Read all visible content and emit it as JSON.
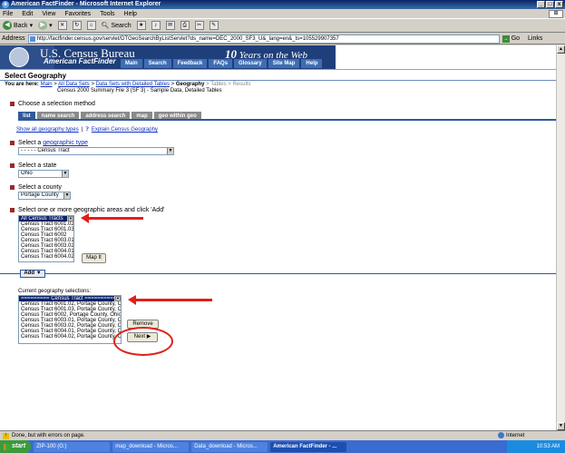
{
  "window": {
    "title": "American FactFinder - Microsoft Internet Explorer",
    "controls": [
      "_",
      "□",
      "x"
    ]
  },
  "menu": [
    "File",
    "Edit",
    "View",
    "Favorites",
    "Tools",
    "Help"
  ],
  "toolbar": {
    "back": "Back",
    "search": "Search",
    "favorites": "Favorites"
  },
  "address": {
    "label": "Address",
    "url": "http://factfinder.census.gov/servlet/DTGeoSearchByListServlet?ds_name=DEC_2000_SF3_U&_lang=en&_ts=105529907357",
    "go": "Go",
    "links": "Links"
  },
  "banner": {
    "title": "U.S. Census Bureau",
    "subtitle": "American FactFinder",
    "tagline_num": "10",
    "tagline": "Years on the Web",
    "nav": [
      "Main",
      "Search",
      "Feedback",
      "FAQs",
      "Glossary",
      "Site Map",
      "Help"
    ]
  },
  "page": {
    "heading": "Select Geography",
    "breadcrumb": {
      "prefix": "You are here:",
      "items": [
        "Main",
        "All Data Sets",
        "Data Sets with Detailed Tables"
      ],
      "current": "Geography",
      "rest": "Tables",
      "last": "Results",
      "sep": ">"
    },
    "dataset": "Census 2000 Summary File 3 (SF 3) - Sample Data, Detailed Tables",
    "method_label": "Choose a selection method",
    "tabs": [
      "list",
      "name search",
      "address search",
      "map",
      "geo within geo"
    ],
    "links": {
      "show_all": "Show all geography types",
      "sep": "|",
      "explain": "Explain Census Geography"
    },
    "geo_type_label_pre": "Select a",
    "geo_type_label_link": "geographic type",
    "geo_type_value": "- - - - - Census Tract",
    "state_label": "Select a state",
    "state_value": "Ohio",
    "county_label": "Select a county",
    "county_value": "Portage County",
    "areas_label": "Select one or more geographic areas and click 'Add'",
    "areas": [
      "All Census Tracts",
      "Census Tract 6001.02",
      "Census Tract 6001.03",
      "Census Tract 6002",
      "Census Tract 6003.01",
      "Census Tract 6003.02",
      "Census Tract 6004.01",
      "Census Tract 6004.02"
    ],
    "map_it": "Map It",
    "add": "Add",
    "current_label": "Current geography selections:",
    "current": [
      "========= Census Tract ==========",
      "Census Tract 6001.02, Portage County, Ohio",
      "Census Tract 6001.03, Portage County, Ohio",
      "Census Tract 6002, Portage County, Ohio",
      "Census Tract 6003.01, Portage County, Ohio",
      "Census Tract 6003.02, Portage County, Ohio",
      "Census Tract 6004.01, Portage County, Ohio",
      "Census Tract 6004.02, Portage County, Ohio"
    ],
    "remove": "Remove",
    "next": "Next"
  },
  "status": {
    "text": "Done, but with errors on page.",
    "zone": "Internet"
  },
  "taskbar": {
    "start": "start",
    "tasks": [
      "ZIP-100 (G:)",
      "map_download - Micros...",
      "Data_download - Micros...",
      "American FactFinder - ..."
    ],
    "clock": "10:53 AM"
  },
  "colors": {
    "annotation": "#e0201a",
    "banner": "#1f3f7a",
    "tab_active": "#2f5a9a"
  }
}
